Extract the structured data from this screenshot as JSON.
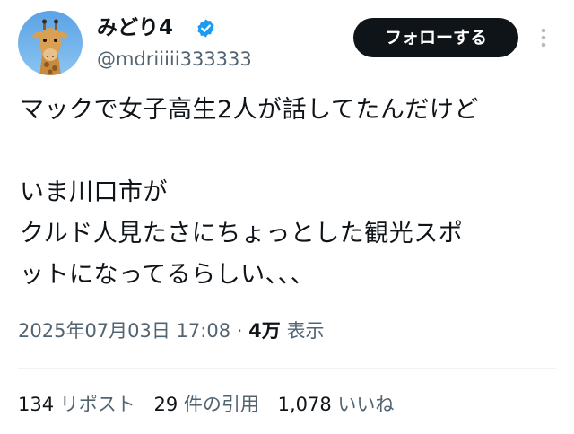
{
  "author": {
    "display_name": "みどり4",
    "handle": "@mdriiiii333333",
    "avatar": "giraffe-avatar",
    "verified_icon": "verified-badge-icon",
    "verified_color": "#1d9bf0"
  },
  "actions": {
    "follow_label": "フォローする",
    "more_icon": "more-vertical-icon"
  },
  "tweet": {
    "text": "マックで女子高生2人が話してたんだけど\n\nいま川口市が\nクルド人見たさにちょっとした観光スポ\nットになってるらしい、、、"
  },
  "meta": {
    "timestamp": "2025年07月03日 17:08",
    "separator": "·",
    "views_count": "4万",
    "views_label": "表示"
  },
  "stats": {
    "reposts_count": "134",
    "reposts_label": "リポスト",
    "quotes_count": "29",
    "quotes_label": "件の引用",
    "likes_count": "1,078",
    "likes_label": "いいね"
  },
  "colors": {
    "text_primary": "#0f1419",
    "text_secondary": "#536471",
    "divider": "#eff3f4",
    "button_bg": "#0f1419"
  }
}
